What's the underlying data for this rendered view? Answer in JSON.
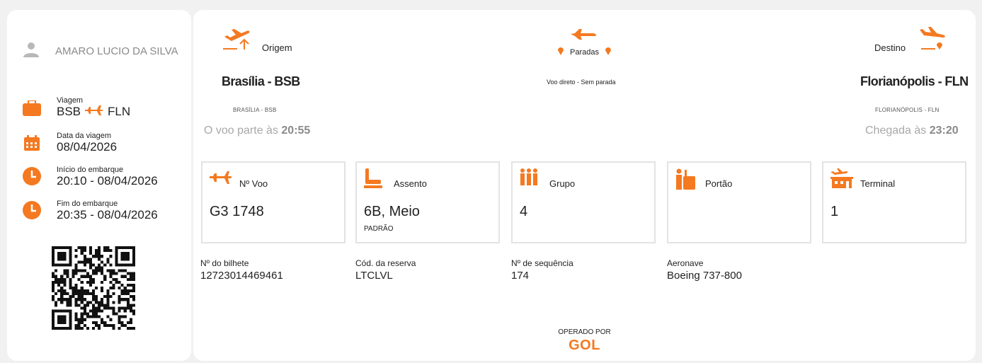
{
  "passenger": {
    "name": "AMARO LUCIO DA SILVA"
  },
  "trip": {
    "viagem_label": "Viagem",
    "from_code": "BSB",
    "to_code": "FLN",
    "date_label": "Data da viagem",
    "date_value": "08/04/2026",
    "boarding_start_label": "Início do embarque",
    "boarding_start_value": "20:10 - 08/04/2026",
    "boarding_end_label": "Fim do embarque",
    "boarding_end_value": "20:35 - 08/04/2026"
  },
  "flight": {
    "origin_label": "Origem",
    "origin_city": "Brasília - BSB",
    "origin_city_small": "BRASÍLIA - BSB",
    "departure_prefix": "O voo parte às",
    "departure_time": "20:55",
    "stops_label": "Paradas",
    "stops_text": "Voo direto - Sem parada",
    "dest_label": "Destino",
    "dest_city": "Florianópolis - FLN",
    "dest_city_small": "FLORIANÓPOLIS - FLN",
    "arrival_prefix": "Chegada às",
    "arrival_time": "23:20"
  },
  "boxes": {
    "flight_no_label": "Nº Voo",
    "flight_no_value": "G3 1748",
    "seat_label": "Assento",
    "seat_value": "6B, Meio",
    "seat_class": "PADRÃO",
    "group_label": "Grupo",
    "group_value": "4",
    "gate_label": "Portão",
    "gate_value": "",
    "terminal_label": "Terminal",
    "terminal_value": "1"
  },
  "details": {
    "ticket_label": "Nº do bilhete",
    "ticket_value": "12723014469461",
    "reservation_label": "Cód. da reserva",
    "reservation_value": "LTCLVL",
    "sequence_label": "Nº de sequência",
    "sequence_value": "174",
    "aircraft_label": "Aeronave",
    "aircraft_value": "Boeing 737-800"
  },
  "operated": {
    "label": "OPERADO POR",
    "brand": "GOL"
  },
  "colors": {
    "accent": "#f47920",
    "muted": "#a8a8a8",
    "border": "#e3e3e3"
  },
  "icons": [
    "user-icon",
    "suitcase-icon",
    "calendar-icon",
    "clock-icon",
    "plane-takeoff-icon",
    "plane-icon",
    "plane-landing-icon",
    "pin-icon",
    "seat-icon",
    "group-icon",
    "gate-icon",
    "terminal-icon",
    "qr-code-icon"
  ]
}
